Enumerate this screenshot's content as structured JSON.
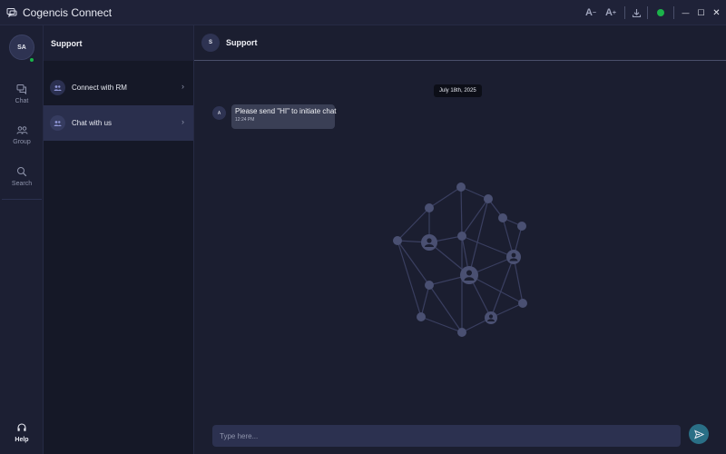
{
  "window": {
    "title": "Cogencis Connect",
    "controls": {
      "font_decrease": "A",
      "font_decrease_mark": "−",
      "font_increase": "A",
      "font_increase_mark": "+",
      "minimize": "—",
      "maximize": "☐",
      "close": "✕"
    },
    "status_color": "#1bb34a"
  },
  "rail": {
    "user_initials": "SA",
    "items": [
      {
        "label": "Chat",
        "icon": "chat-icon"
      },
      {
        "label": "Group",
        "icon": "group-icon"
      },
      {
        "label": "Search",
        "icon": "search-icon"
      }
    ],
    "help": {
      "label": "Help",
      "icon": "headset-icon"
    }
  },
  "panel": {
    "title": "Support",
    "items": [
      {
        "label": "Connect with RM",
        "icon": "users-icon",
        "active": false
      },
      {
        "label": "Chat with us",
        "icon": "users-icon",
        "active": true
      }
    ]
  },
  "chat": {
    "header": {
      "initial": "S",
      "title": "Support"
    },
    "date": "July 18th, 2025",
    "messages": [
      {
        "avatar": "A",
        "text": "Please send \"HI\" to initiate chat",
        "time": "12:24 PM"
      }
    ],
    "input": {
      "placeholder": "Type here...",
      "value": ""
    },
    "send_icon": "send-icon"
  },
  "colors": {
    "background": "#1b1e30",
    "panel": "#151827",
    "accent_active": "#2a2f4d",
    "send_button": "#2a6f86",
    "online": "#1bb34a"
  }
}
